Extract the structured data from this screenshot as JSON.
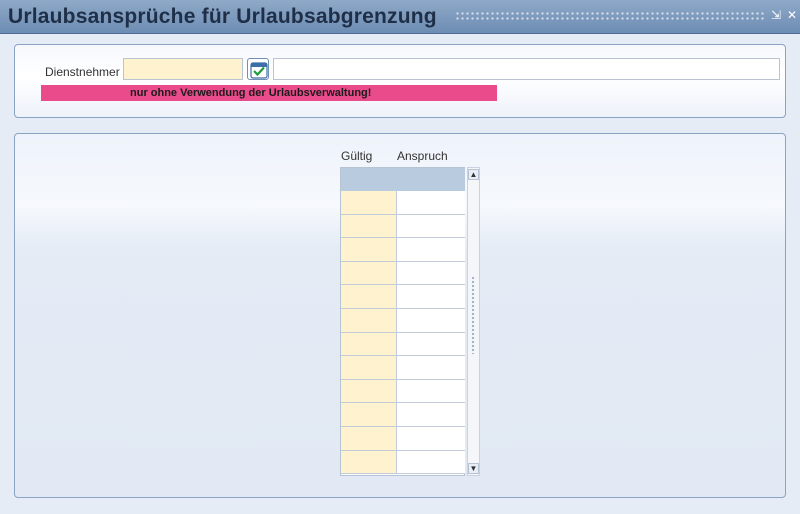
{
  "window": {
    "title": "Urlaubsansprüche für Urlaubsabgrenzung",
    "minimize_glyph": "⇲",
    "close_glyph": "✕"
  },
  "form": {
    "dienstnehmer_label": "Dienstnehmer",
    "dienstnehmer_value": "",
    "dienstnehmer_name_value": "",
    "picker_icon": "calendar-check-icon",
    "warning_text": "nur ohne Verwendung der Urlaubsverwaltung!"
  },
  "table": {
    "columns": [
      "Gültig",
      "Anspruch"
    ],
    "rows": [
      [
        "",
        ""
      ],
      [
        "",
        ""
      ],
      [
        "",
        ""
      ],
      [
        "",
        ""
      ],
      [
        "",
        ""
      ],
      [
        "",
        ""
      ],
      [
        "",
        ""
      ],
      [
        "",
        ""
      ],
      [
        "",
        ""
      ],
      [
        "",
        ""
      ],
      [
        "",
        ""
      ],
      [
        "",
        ""
      ]
    ]
  },
  "scrollbar": {
    "up_glyph": "▲",
    "down_glyph": "▼"
  },
  "colors": {
    "titlebar": "#7c98bd",
    "warning": "#e94b8b",
    "required_field": "#fff2cf",
    "header_band": "#b9cbdf"
  }
}
